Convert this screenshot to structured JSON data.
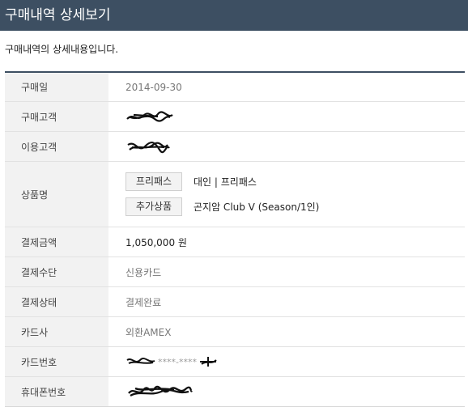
{
  "header": {
    "title": "구매내역 상세보기"
  },
  "intro": {
    "text": "구매내역의 상세내용입니다."
  },
  "rows": {
    "purchase_date": {
      "label": "구매일",
      "value": "2014-09-30"
    },
    "buyer": {
      "label": "구매고객"
    },
    "user": {
      "label": "이용고객"
    },
    "product": {
      "label": "상품명",
      "items": [
        {
          "tag": "프리패스",
          "name": "대인 | 프리패스"
        },
        {
          "tag": "추가상품",
          "name": "곤지암 Club V (Season/1인)"
        }
      ]
    },
    "amount": {
      "label": "결제금액",
      "value": "1,050,000 원"
    },
    "method": {
      "label": "결제수단",
      "value": "신용카드"
    },
    "status": {
      "label": "결제상태",
      "value": "결제완료"
    },
    "card_company": {
      "label": "카드사",
      "value": "외환AMEX"
    },
    "card_number": {
      "label": "카드번호",
      "masked_middle": "****-****"
    },
    "phone": {
      "label": "휴대폰번호"
    }
  }
}
